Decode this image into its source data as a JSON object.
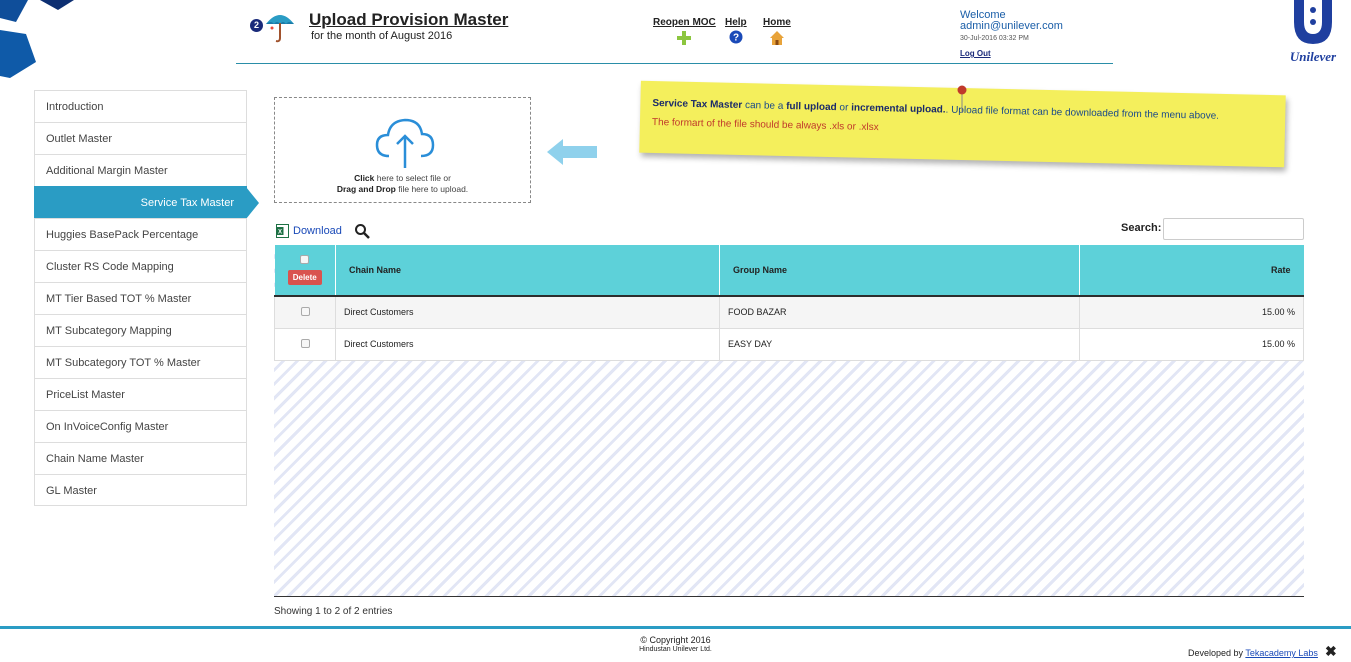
{
  "header": {
    "badge_count": "2",
    "title": "Upload Provision Master",
    "subtitle": "for the month of August 2016",
    "nav": {
      "reopen_label": "Reopen MOC",
      "help_label": "Help",
      "home_label": "Home"
    },
    "welcome": "Welcome",
    "user_email": "admin@unilever.com",
    "timestamp": "30-Jul-2016 03:32 PM",
    "logout_label": "Log Out",
    "logo_text": "Unilever"
  },
  "sidebar": {
    "items": [
      {
        "label": "Introduction"
      },
      {
        "label": "Outlet Master"
      },
      {
        "label": "Additional Margin Master"
      },
      {
        "label": "Service Tax Master"
      },
      {
        "label": "Huggies BasePack Percentage"
      },
      {
        "label": "Cluster RS Code Mapping"
      },
      {
        "label": "MT Tier Based TOT % Master"
      },
      {
        "label": "MT Subcategory Mapping"
      },
      {
        "label": "MT Subcategory TOT % Master"
      },
      {
        "label": "PriceList Master"
      },
      {
        "label": "On InVoiceConfig Master"
      },
      {
        "label": "Chain Name Master"
      },
      {
        "label": "GL Master"
      }
    ],
    "active_index": 3
  },
  "upload": {
    "click_bold": "Click",
    "click_rest": " here to select file or",
    "drag_bold": "Drag and Drop",
    "drag_rest": " file here to upload."
  },
  "note": {
    "l1_bold1": "Service Tax Master",
    "l1_t1": " can be a ",
    "l1_bold2": "full upload",
    "l1_t2": " or ",
    "l1_bold3": "incremental upload.",
    "l1_t3": ". Upload file format can be downloaded from the menu above.",
    "l2": "The formart of the file should be always .xls or .xlsx"
  },
  "toolbar": {
    "download_label": "Download",
    "search_label": "Search:",
    "search_value": ""
  },
  "table": {
    "delete_label": "Delete",
    "columns": [
      "Chain Name",
      "Group Name",
      "Rate"
    ],
    "rows": [
      {
        "chain": "Direct Customers",
        "group": "FOOD BAZAR",
        "rate": "15.00 %"
      },
      {
        "chain": "Direct Customers",
        "group": "EASY DAY",
        "rate": "15.00 %"
      }
    ],
    "entries_text": "Showing 1 to 2 of 2 entries"
  },
  "footer": {
    "copyright": "Copyright 2016",
    "company": "Hindustan Unilever Ltd.",
    "developed_by": "Developed by ",
    "developer": "Tekacademy Labs",
    "close_symbol": "✖"
  },
  "colors": {
    "accent": "#2a9cc4",
    "table_header": "#5dd1d9",
    "note_bg": "#f4ef5c",
    "delete": "#d9534f"
  }
}
